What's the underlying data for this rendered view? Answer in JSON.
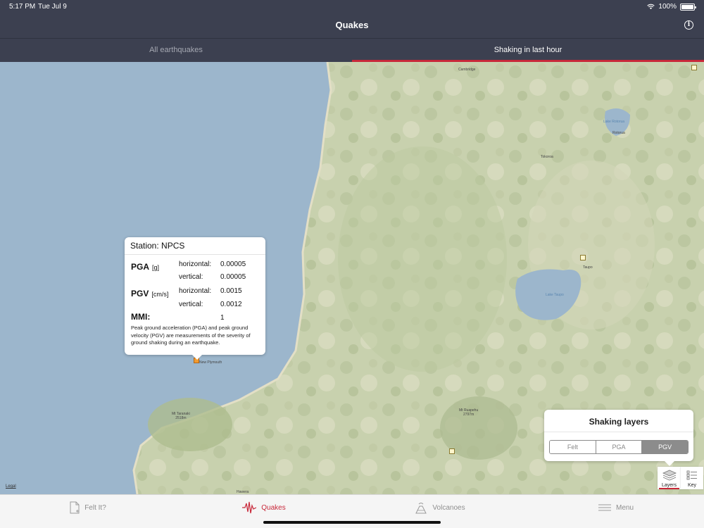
{
  "status_bar": {
    "time": "5:17 PM",
    "date": "Tue Jul 9",
    "battery": "100%"
  },
  "nav": {
    "title": "Quakes",
    "info_icon": "info-icon"
  },
  "segment_tabs": [
    {
      "label": "All earthquakes",
      "active": false
    },
    {
      "label": "Shaking in last hour",
      "active": true
    }
  ],
  "map": {
    "legal": "Legal",
    "places": [
      {
        "name": "Cambridge"
      },
      {
        "name": "Rotorua"
      },
      {
        "name": "Tokoroa"
      },
      {
        "name": "Taupo"
      },
      {
        "name": "New Plymouth"
      },
      {
        "name": "Mt Taranaki\n2518m"
      },
      {
        "name": "Mt Ruapehu\n2797m"
      },
      {
        "name": "Hawera"
      }
    ],
    "lakes": [
      {
        "name": "Lake Rotorua"
      },
      {
        "name": "Lake Taupo"
      }
    ]
  },
  "station_popover": {
    "title": "Station: NPCS",
    "pga_label": "PGA",
    "pga_unit": "[g]",
    "pga_horizontal_label": "horizontal:",
    "pga_horizontal_value": "0.00005",
    "pga_vertical_label": "vertical:",
    "pga_vertical_value": "0.00005",
    "pgv_label": "PGV",
    "pgv_unit": "[cm/s]",
    "pgv_horizontal_label": "horizontal:",
    "pgv_horizontal_value": "0.0015",
    "pgv_vertical_label": "vertical:",
    "pgv_vertical_value": "0.0012",
    "mmi_label": "MMI:",
    "mmi_value": "1",
    "description": "Peak ground acceleration (PGA) and peak ground velocity (PGV) are measurements of the severity of ground shaking during an earthquake."
  },
  "shaking_layers": {
    "title": "Shaking layers",
    "options": [
      "Felt",
      "PGA",
      "PGV"
    ],
    "selected": "PGV"
  },
  "map_controls": {
    "layers_label": "Layers",
    "key_label": "Key"
  },
  "tabbar": [
    {
      "label": "Felt It?",
      "icon": "felt-it-icon",
      "active": false
    },
    {
      "label": "Quakes",
      "icon": "seismograph-icon",
      "active": true
    },
    {
      "label": "Volcanoes",
      "icon": "volcano-icon",
      "active": false
    },
    {
      "label": "Menu",
      "icon": "menu-icon",
      "active": false
    }
  ],
  "colors": {
    "header_bg": "#3c4050",
    "accent_red": "#c8283a",
    "sea": "#9cb6cc",
    "land": "#c9d2b0",
    "selected_segment": "#8c8c8c"
  }
}
